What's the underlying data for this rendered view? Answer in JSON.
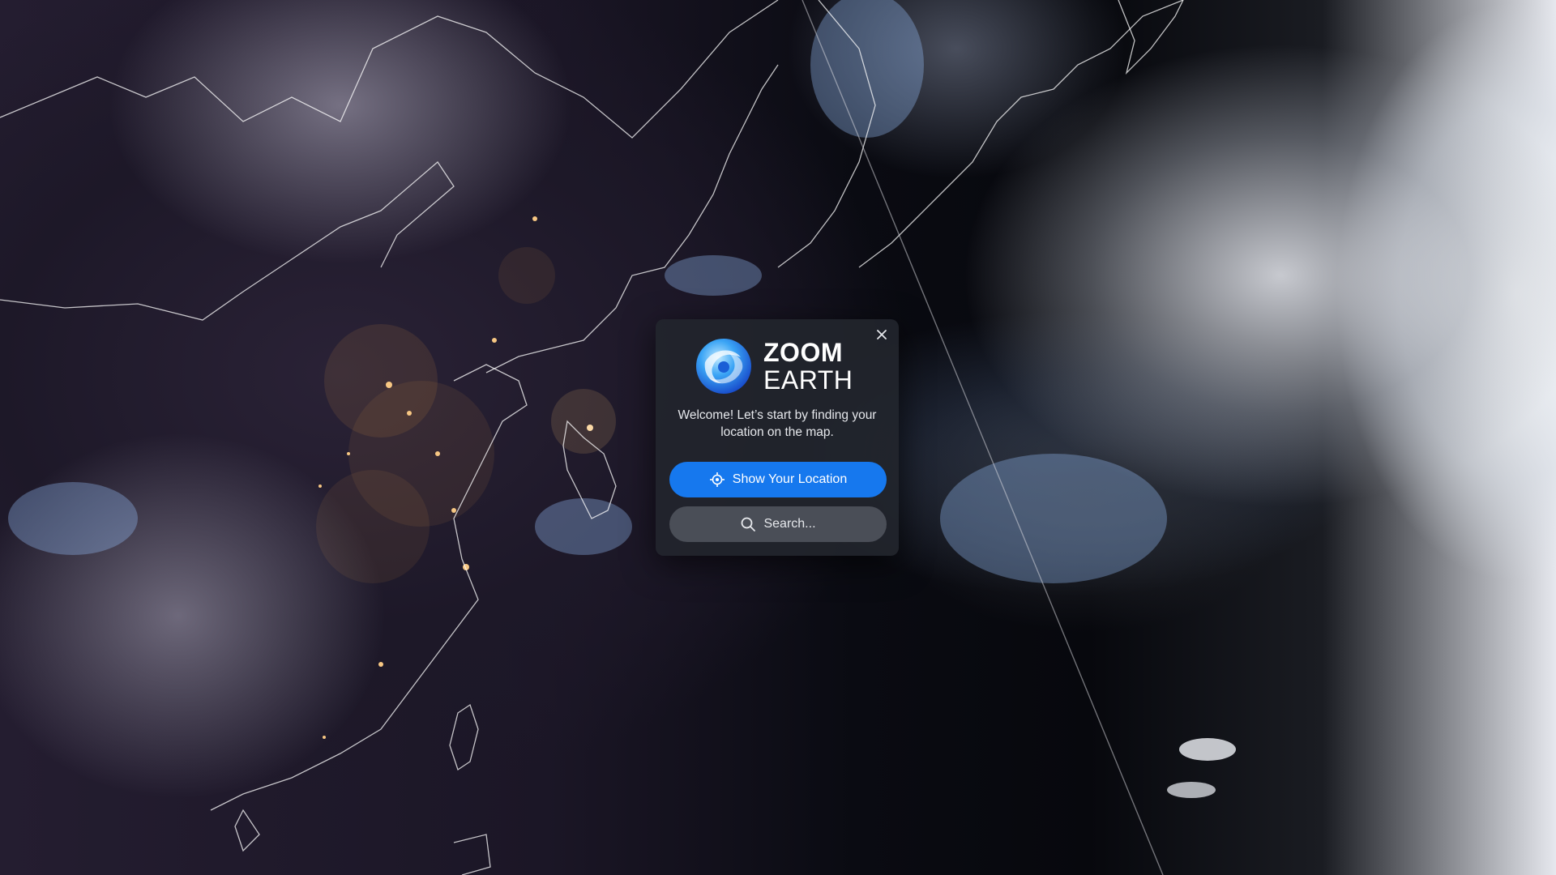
{
  "app": {
    "name": "Zoom Earth"
  },
  "modal": {
    "logo": {
      "line1": "ZOOM",
      "line2": "EARTH",
      "icon": "zoom-earth-globe-icon"
    },
    "welcome_text": "Welcome! Let’s start by finding your location on the map.",
    "show_location_label": "Show Your Location",
    "show_location_icon": "crosshair-location-icon",
    "search_label": "Search...",
    "search_icon": "search-icon",
    "close_icon": "close-icon"
  },
  "colors": {
    "primary_button": "#1678ee",
    "secondary_button": "#4a4e57",
    "modal_background": "#22252c"
  }
}
